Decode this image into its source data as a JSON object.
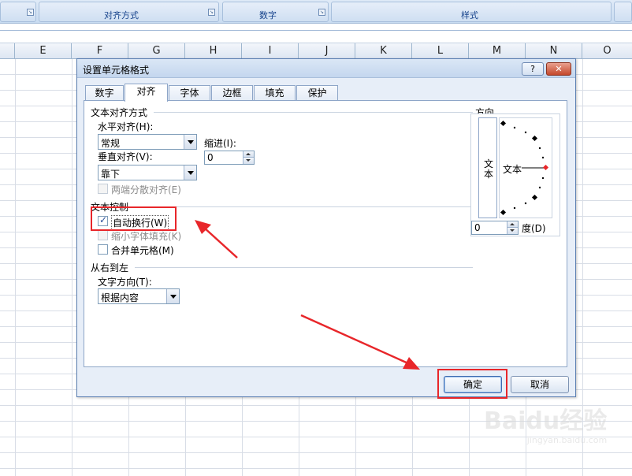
{
  "ribbon": {
    "groups": [
      "对齐方式",
      "数字",
      "样式"
    ]
  },
  "columns": [
    "E",
    "F",
    "G",
    "H",
    "I",
    "J",
    "K",
    "L",
    "M",
    "N",
    "O"
  ],
  "dialog": {
    "title": "设置单元格格式",
    "help_button": "?",
    "close_button": "✕",
    "tabs": [
      "数字",
      "对齐",
      "字体",
      "边框",
      "填充",
      "保护"
    ],
    "active_tab": "对齐",
    "text_alignment": {
      "section": "文本对齐方式",
      "horizontal_label": "水平对齐(H):",
      "horizontal_value": "常规",
      "indent_label": "缩进(I):",
      "indent_value": "0",
      "vertical_label": "垂直对齐(V):",
      "vertical_value": "靠下",
      "justify_distributed_label": "两端分散对齐(E)"
    },
    "text_control": {
      "section": "文本控制",
      "wrap_text_label": "自动换行(W)",
      "wrap_text_checked": true,
      "shrink_to_fit_label": "缩小字体填充(K)",
      "merge_cells_label": "合并单元格(M)"
    },
    "rtl": {
      "section": "从右到左",
      "direction_label": "文字方向(T):",
      "direction_value": "根据内容"
    },
    "orientation": {
      "section": "方向",
      "vertical_text": "文本",
      "dial_text": "文本",
      "degrees_value": "0",
      "degrees_label": "度(D)"
    },
    "ok_button": "确定",
    "cancel_button": "取消"
  },
  "watermark": {
    "brand": "Baidu经验",
    "url": "jingyan.baidu.com"
  },
  "colors": {
    "highlight": "#e8262a",
    "dialog_bg": "#e7eef8"
  }
}
